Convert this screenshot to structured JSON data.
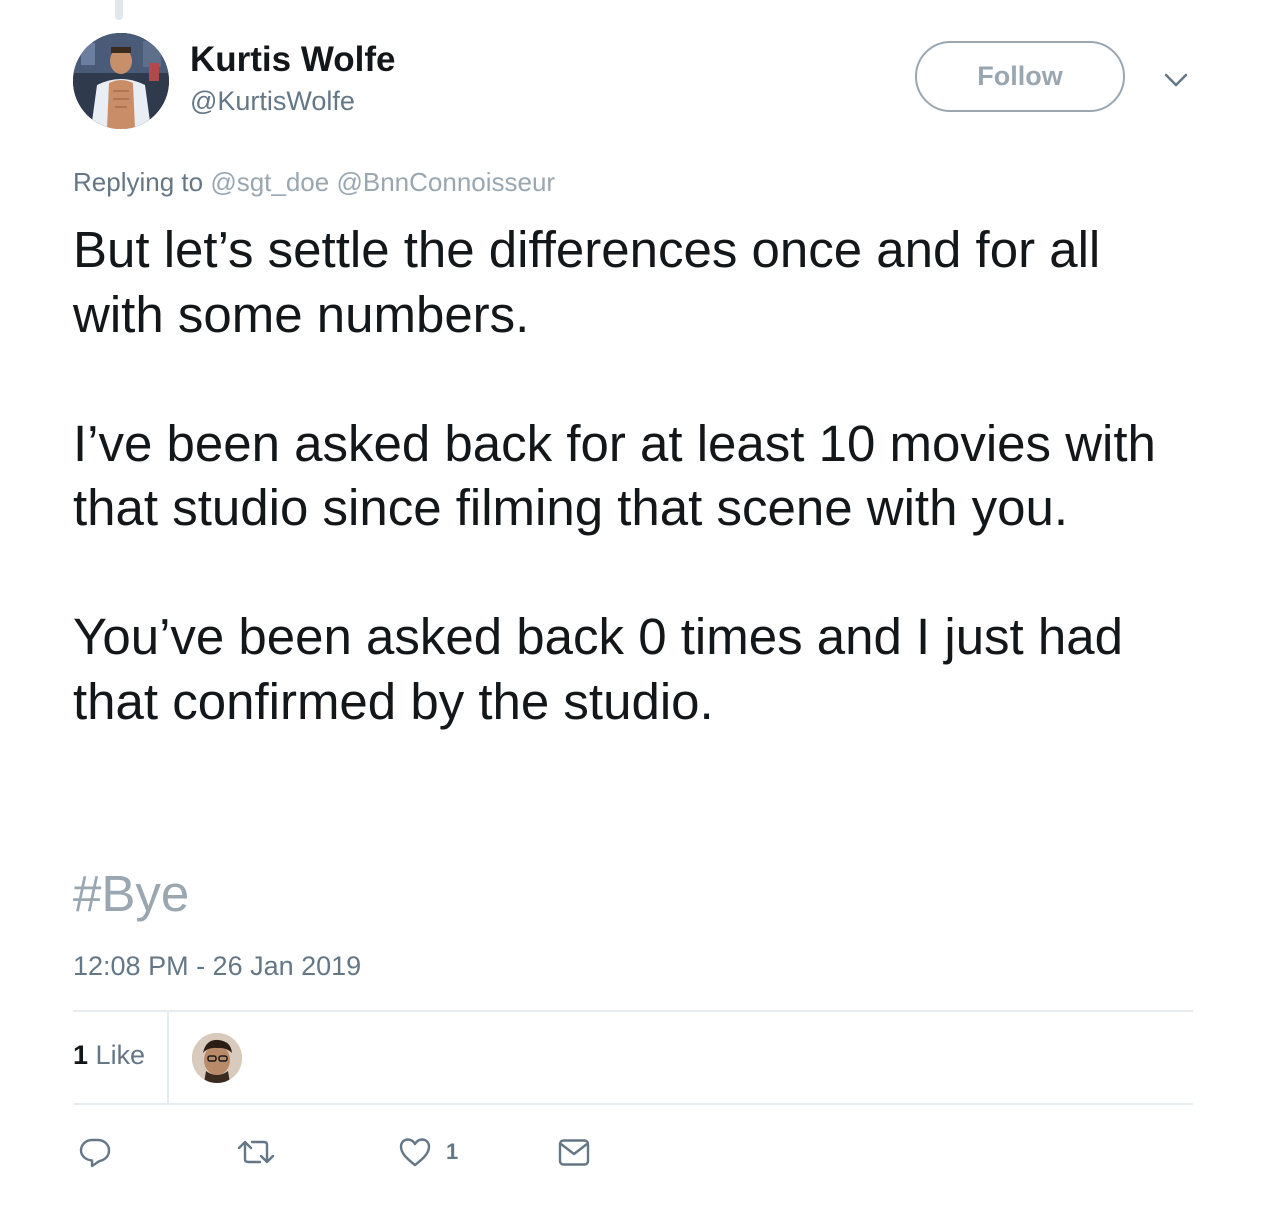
{
  "tweet": {
    "author": {
      "display_name": "Kurtis Wolfe",
      "screen_name": "@KurtisWolfe",
      "avatar_icon": "profile-photo"
    },
    "follow_label": "Follow",
    "menu_icon": "chevron-down-icon",
    "replying_label": "Replying to",
    "reply_mentions": [
      "@sgt_doe",
      "@BnnConnoisseur"
    ],
    "paragraphs": [
      "But let’s settle the differences once and for all with some numbers.",
      "I’ve been asked back for at least 10 movies with that studio since filming that scene with you.",
      "You’ve been asked back 0 times and I just had that confirmed by the studio."
    ],
    "hashtag": "#Bye",
    "timestamp": "12:08 PM - 26 Jan 2019",
    "likes": {
      "count": "1",
      "label": "Like"
    },
    "actions": {
      "reply_icon": "reply-icon",
      "retweet_icon": "retweet-icon",
      "like_icon": "heart-icon",
      "like_count": "1",
      "message_icon": "envelope-icon"
    },
    "colors": {
      "text": "#14171a",
      "secondary": "#657786",
      "muted_link": "#9aa7b1",
      "divider": "#e6ecf0"
    }
  }
}
